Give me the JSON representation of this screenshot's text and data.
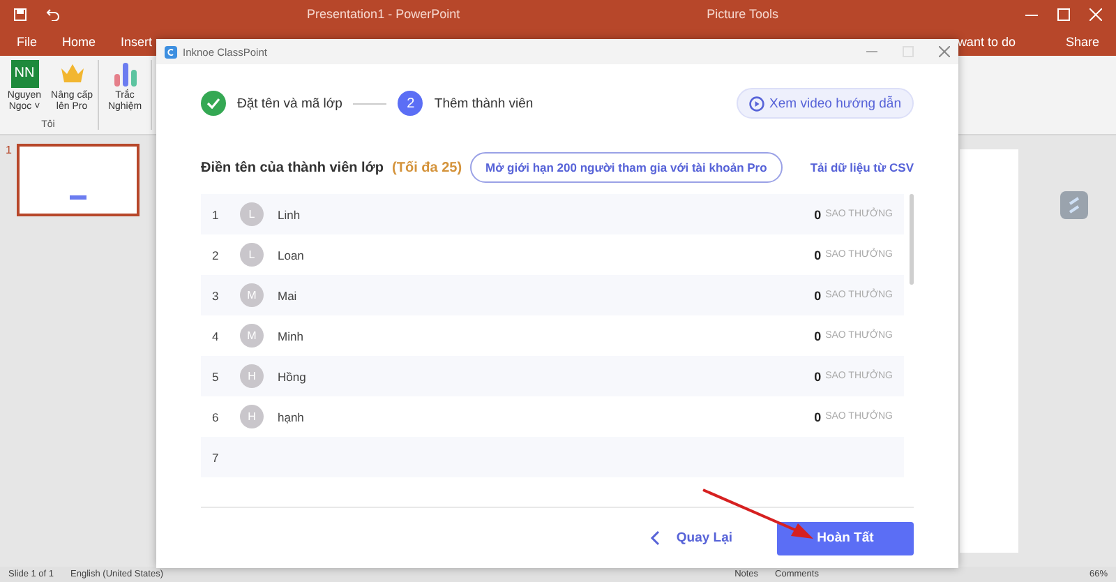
{
  "app": {
    "title": "Presentation1  -  PowerPoint",
    "context_tab": "Picture Tools",
    "share": "Share",
    "tell_me": "want to do"
  },
  "ribbon_tabs": [
    {
      "label": "File"
    },
    {
      "label": "Home"
    },
    {
      "label": "Insert"
    }
  ],
  "ribbon": {
    "groups": [
      {
        "label": "Tôi",
        "items": [
          {
            "kind": "avatar",
            "initials": "NN",
            "label": "Nguyen Ngoc ˅"
          },
          {
            "kind": "crown",
            "label": "Nâng cấp lên Pro"
          }
        ]
      },
      {
        "items": [
          {
            "kind": "bars",
            "label": "Trắc Nghiệm"
          }
        ]
      }
    ]
  },
  "thumbnails": [
    {
      "number": "1",
      "selected": true
    }
  ],
  "dialog": {
    "title": "Inknoe ClassPoint",
    "steps": [
      {
        "completed": true,
        "label": "Đặt tên và mã lớp"
      },
      {
        "completed": false,
        "number": "2",
        "label": "Thêm thành viên"
      }
    ],
    "video_button": "Xem video hướng dẫn",
    "heading": "Điền tên của thành viên lớp",
    "limit": "(Tối đa 25)",
    "pro_button": "Mở giới hạn 200 người tham gia với tài khoản Pro",
    "csv_link": "Tải dữ liệu từ CSV",
    "members": [
      {
        "number": "1",
        "initial": "L",
        "name": "Linh",
        "stars": "0",
        "stars_label": "SAO THƯỞNG"
      },
      {
        "number": "2",
        "initial": "L",
        "name": "Loan",
        "stars": "0",
        "stars_label": "SAO THƯỞNG"
      },
      {
        "number": "3",
        "initial": "M",
        "name": "Mai",
        "stars": "0",
        "stars_label": "SAO THƯỞNG"
      },
      {
        "number": "4",
        "initial": "M",
        "name": "Minh",
        "stars": "0",
        "stars_label": "SAO THƯỞNG"
      },
      {
        "number": "5",
        "initial": "H",
        "name": "Hồng",
        "stars": "0",
        "stars_label": "SAO THƯỞNG"
      },
      {
        "number": "6",
        "initial": "H",
        "name": "hạnh",
        "stars": "0",
        "stars_label": "SAO THƯỞNG"
      },
      {
        "number": "7"
      }
    ],
    "back_button": "Quay Lại",
    "finish_button": "Hoàn Tất"
  },
  "status_bar": {
    "slide": "Slide 1 of 1",
    "language": "English (United States)",
    "notes": "Notes",
    "comments": "Comments",
    "zoom": "66%"
  }
}
